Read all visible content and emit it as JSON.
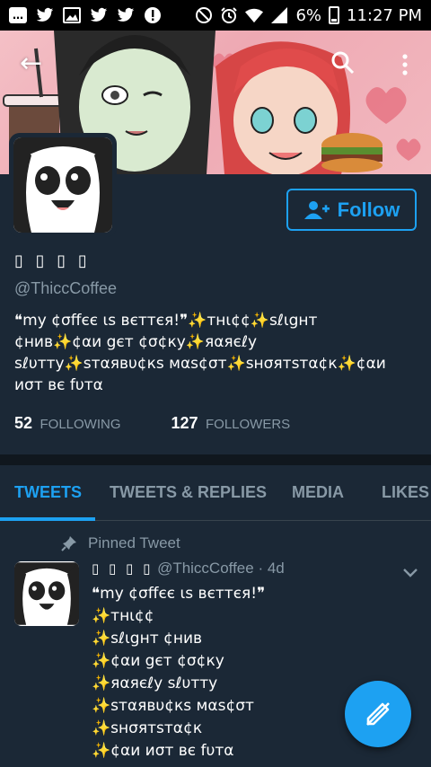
{
  "status_bar": {
    "icons": [
      "chat-icon",
      "twitter-icon",
      "image-icon",
      "twitter-icon",
      "twitter-icon",
      "alert-icon",
      "dnd-icon",
      "alarm-icon",
      "wifi-icon",
      "signal-icon",
      "battery-icon"
    ],
    "battery": "6%",
    "time": "11:27 PM"
  },
  "header": {
    "back_icon": "back-arrow-icon",
    "search_icon": "search-icon",
    "more_icon": "more-vertical-icon"
  },
  "profile": {
    "follow_label": "Follow",
    "display_name": "▯ ▯ ▯ ▯",
    "handle": "@ThiccCoffee",
    "bio": "❝my ¢σffєє ιѕ вєттєя!❞✨тнι¢¢✨ѕℓιgнт ¢нив✨¢αи gєт ¢σ¢ку✨яαяєℓу ѕℓυтту✨ѕтαявυ¢кѕ мαѕ¢σт✨ѕнσятѕтα¢к✨¢αи иσт вє fυтα",
    "following_count": "52",
    "following_label": "FOLLOWING",
    "followers_count": "127",
    "followers_label": "FOLLOWERS"
  },
  "tabs": [
    {
      "label": "TWEETS",
      "active": true
    },
    {
      "label": "TWEETS & REPLIES",
      "active": false
    },
    {
      "label": "MEDIA",
      "active": false
    },
    {
      "label": "LIKES",
      "active": false
    }
  ],
  "tweet": {
    "pinned_label": "Pinned Tweet",
    "name": "▯ ▯ ▯ ▯",
    "handle": "@ThiccCoffee",
    "time": "· 4d",
    "lines": [
      "❝my ¢σffєє ιѕ вєттєя!❞",
      "✨тнι¢¢",
      "✨ѕℓιgнт ¢нив",
      "✨¢αи gєт ¢σ¢ку",
      "✨яαяєℓу ѕℓυтту",
      "✨ѕтαявυ¢кѕ мαѕ¢σт",
      "✨ѕнσятѕтα¢к",
      "✨¢αи иσт вє fυтα"
    ]
  },
  "fab_icon": "compose-icon",
  "colors": {
    "background": "#1b2836",
    "accent": "#1da1f2",
    "muted": "#8899a6",
    "separator": "#10171e"
  }
}
